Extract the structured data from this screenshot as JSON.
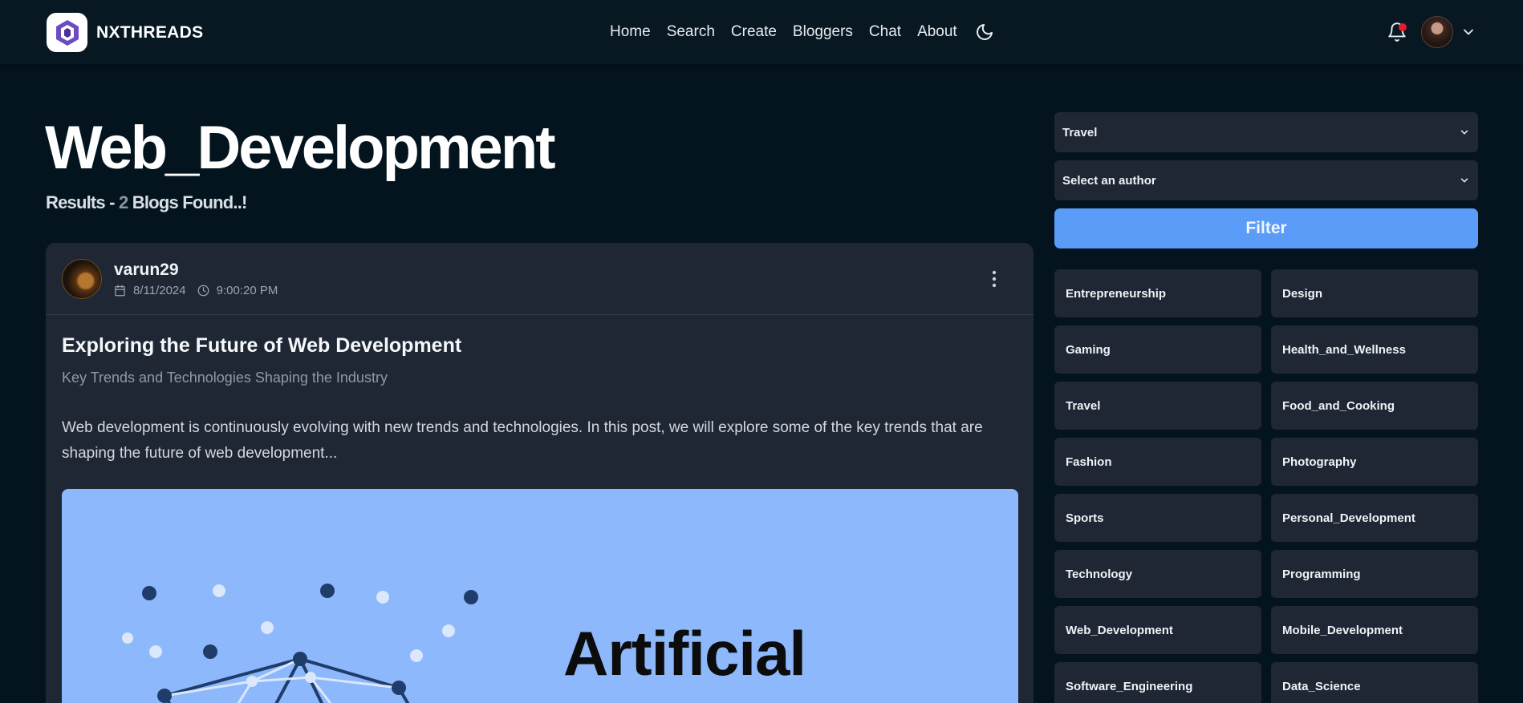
{
  "nav": {
    "brand": "NXTHREADS",
    "links": [
      "Home",
      "Search",
      "Create",
      "Bloggers",
      "Chat",
      "About"
    ]
  },
  "hero": {
    "title": "Web_Development",
    "results_prefix": "Results - ",
    "results_count": "2",
    "results_suffix": " Blogs Found..!"
  },
  "post": {
    "author": "varun29",
    "date": "8/11/2024",
    "time": "9:00:20 PM",
    "title": "Exploring the Future of Web Development",
    "subtitle": "Key Trends and Technologies Shaping the Industry",
    "excerpt": "Web development is continuously evolving with new trends and technologies. In this post, we will explore some of the key trends that are shaping the future of web development...",
    "image_text": "Artificial"
  },
  "sidebar": {
    "category_select": "Travel",
    "author_select": "Select an author",
    "filter_label": "Filter",
    "categories": [
      "Entrepreneurship",
      "Design",
      "Gaming",
      "Health_and_Wellness",
      "Travel",
      "Food_and_Cooking",
      "Fashion",
      "Photography",
      "Sports",
      "Personal_Development",
      "Technology",
      "Programming",
      "Web_Development",
      "Mobile_Development",
      "Software_Engineering",
      "Data_Science"
    ]
  },
  "colors": {
    "background": "#03141e",
    "card": "#1f2735",
    "accent": "#5a9cf7",
    "image_bg": "#8db8fb",
    "notification_dot": "#e11d2e"
  }
}
